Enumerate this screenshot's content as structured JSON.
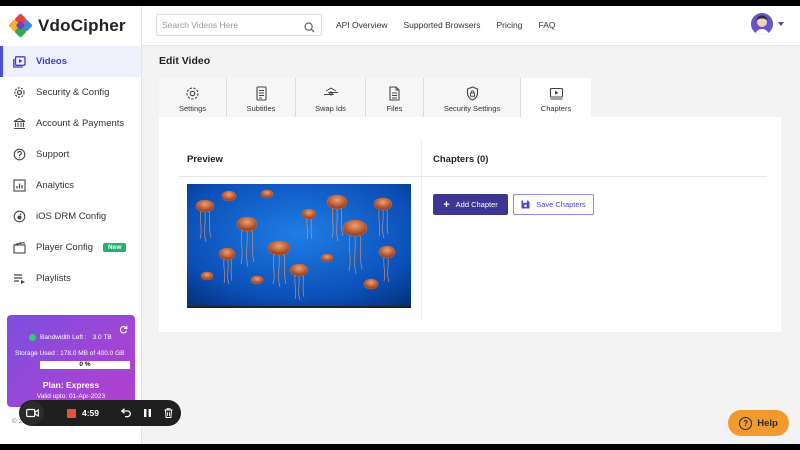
{
  "brand": {
    "name": "VdoCipher"
  },
  "sidebar": {
    "items": [
      {
        "label": "Videos",
        "icon": "video-library-icon",
        "active": true
      },
      {
        "label": "Security & Config",
        "icon": "gear-icon"
      },
      {
        "label": "Account & Payments",
        "icon": "bank-icon"
      },
      {
        "label": "Support",
        "icon": "help-circle-icon"
      },
      {
        "label": "Analytics",
        "icon": "bar-chart-icon"
      },
      {
        "label": "iOS DRM Config",
        "icon": "ios-icon"
      },
      {
        "label": "Player Config",
        "icon": "clapperboard-icon",
        "badge": "New"
      },
      {
        "label": "Playlists",
        "icon": "playlist-icon"
      }
    ]
  },
  "plan": {
    "bandwidth_label": "Bandwidth Left :",
    "bandwidth_value": "3.0 TB",
    "storage_text": "Storage Used : 178.0 MB of 400.0 GB",
    "storage_percent_label": "0 %",
    "storage_fraction": 0.0,
    "plan_name": "Plan: Express",
    "valid_text": "Valid upto: 01-Apr-2023"
  },
  "footer": {
    "copyright": "© 2... VdoCipher..."
  },
  "recorder": {
    "time": "4:59",
    "state_color": "#e5533f"
  },
  "topbar": {
    "search_placeholder": "Search Videos Here",
    "links": [
      "API Overview",
      "Supported Browsers",
      "Pricing",
      "FAQ"
    ]
  },
  "page": {
    "title": "Edit Video"
  },
  "tabs": [
    {
      "label": "Settings",
      "icon": "gear-icon"
    },
    {
      "label": "Subtitles",
      "icon": "document-icon"
    },
    {
      "label": "Swap Ids",
      "icon": "swap-icon"
    },
    {
      "label": "Files",
      "icon": "file-icon"
    },
    {
      "label": "Security Settings",
      "icon": "shield-lock-icon"
    },
    {
      "label": "Chapters",
      "icon": "video-chapter-icon",
      "active": true
    }
  ],
  "panel": {
    "preview_title": "Preview",
    "chapters_title": "Chapters (0)",
    "add_chapter_label": "Add Chapter",
    "save_chapters_label": "Save Chapters"
  },
  "help": {
    "label": "Help"
  },
  "colors": {
    "accent": "#4a4ed6",
    "primary_button": "#3d3791",
    "help": "#f29a2e",
    "plan_gradient_start": "#7b4fe0",
    "badge_new": "#21b36b"
  }
}
